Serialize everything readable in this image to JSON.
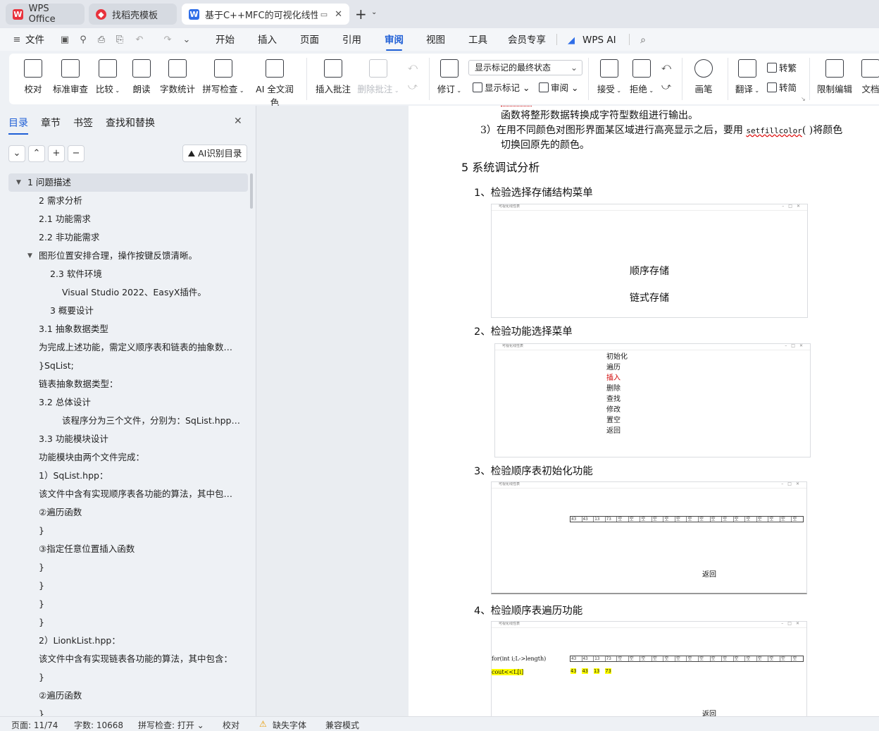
{
  "tabs": [
    {
      "label": "WPS Office",
      "icon": "wps-logo-icon"
    },
    {
      "label": "找稻壳模板",
      "icon": "docer-icon"
    },
    {
      "label": "基于C++MFC的可视化线性表",
      "icon": "word-doc-icon"
    }
  ],
  "menu": {
    "file": "文件",
    "items": [
      "开始",
      "插入",
      "页面",
      "引用",
      "审阅",
      "视图",
      "工具",
      "会员专享"
    ],
    "active": "审阅",
    "wps_ai": "WPS AI"
  },
  "ribbon": {
    "proofread": "校对",
    "standard_review": "标准审查",
    "compare": "比较",
    "read_aloud": "朗读",
    "word_count": "字数统计",
    "spell_check": "拼写检查",
    "ai_polish": "AI 全文润色",
    "insert_comment": "插入批注",
    "delete_comment": "删除批注",
    "track_changes": "修订",
    "markup_state": "显示标记的最终状态",
    "show_markup": "显示标记",
    "review": "审阅",
    "accept": "接受",
    "reject": "拒绝",
    "pen": "画笔",
    "translate": "翻译",
    "to_traditional": "转繁",
    "to_simplified": "转简",
    "restrict_edit": "限制编辑",
    "doc_protect": "文档"
  },
  "sidebar": {
    "tabs": [
      "目录",
      "章节",
      "书签",
      "查找和替换"
    ],
    "ai_toc": "AI识别目录",
    "toc": [
      {
        "text": "1  问题描述",
        "level": 0,
        "expander": "open",
        "selected": true
      },
      {
        "text": "2  需求分析",
        "level": 1
      },
      {
        "text": "2.1  功能需求",
        "level": 1
      },
      {
        "text": "2.2  非功能需求",
        "level": 1
      },
      {
        "text": "图形位置安排合理，操作按键反馈清晰。",
        "level": 1,
        "expander": "open"
      },
      {
        "text": "2.3  软件环境",
        "level": 2
      },
      {
        "text": "Visual Studio 2022、EasyX插件。",
        "level": 3
      },
      {
        "text": "3  概要设计",
        "level": 2
      },
      {
        "text": "3.1 抽象数据类型",
        "level": 1
      },
      {
        "text": "为完成上述功能，需定义顺序表和链表的抽象数据类 ...",
        "level": 1
      },
      {
        "text": "}SqList;",
        "level": 1
      },
      {
        "text": "链表抽象数据类型：",
        "level": 1
      },
      {
        "text": "3.2  总体设计",
        "level": 1
      },
      {
        "text": "该程序分为三个文件，分别为：SqList.hpp、L ...",
        "level": 3
      },
      {
        "text": "3.3  功能模块设计",
        "level": 1
      },
      {
        "text": "功能模块由两个文件完成：",
        "level": 1
      },
      {
        "text": "1）SqList.hpp：",
        "level": 1
      },
      {
        "text": "该文件中含有实现顺序表各功能的算法，其中包含：",
        "level": 1
      },
      {
        "text": "②遍历函数",
        "level": 1
      },
      {
        "text": "}",
        "level": 1
      },
      {
        "text": "③指定任意位置插入函数",
        "level": 1
      },
      {
        "text": "}",
        "level": 1
      },
      {
        "text": "}",
        "level": 1
      },
      {
        "text": "}",
        "level": 1
      },
      {
        "text": "}",
        "level": 1
      },
      {
        "text": "2）LionkList.hpp：",
        "level": 1
      },
      {
        "text": "该文件中含有实现链表各功能的算法，其中包含：",
        "level": 1
      },
      {
        "text": "}",
        "level": 1
      },
      {
        "text": "②遍历函数",
        "level": 1
      },
      {
        "text": "}",
        "level": 1
      }
    ]
  },
  "document": {
    "line1": "函数将整形数据转换成字符型数组进行输出。",
    "line2_prefix": "3）在用不同颜色对图形界面某区域进行高亮显示之后，要用 ",
    "line2_code": "setfillcolor",
    "line2_suffix": "( )将颜色",
    "line3": "切换回原先的颜色。",
    "section_title": "5  系统调试分析",
    "items": [
      "1、检验选择存储结构菜单",
      "2、检验功能选择菜单",
      "3、检验顺序表初始化功能",
      "4、检验顺序表遍历功能"
    ],
    "shot_title": "可视化线性表",
    "menu1": [
      "顺序存储",
      "链式存储"
    ],
    "menu2": [
      "初始化",
      "遍历",
      "插入",
      "删除",
      "查找",
      "修改",
      "置空",
      "返回"
    ],
    "menu2_highlight": "插入",
    "init_values": [
      "43",
      "43",
      "13",
      "73"
    ],
    "empty_cell": "空",
    "back": "返回",
    "code1": "for(int i;L->length)",
    "code2": "cout<<L[i]",
    "traverse_values": [
      "43",
      "43",
      "13",
      "73"
    ]
  },
  "status": {
    "page": "页面: 11/74",
    "words": "字数: 10668",
    "spell": "拼写检查: 打开",
    "proof": "校对",
    "missing_font": "缺失字体",
    "compat": "兼容模式"
  },
  "colors": {
    "accent": "#1f5fd6",
    "highlight": "#ffff00",
    "red_text": "#d00000"
  }
}
